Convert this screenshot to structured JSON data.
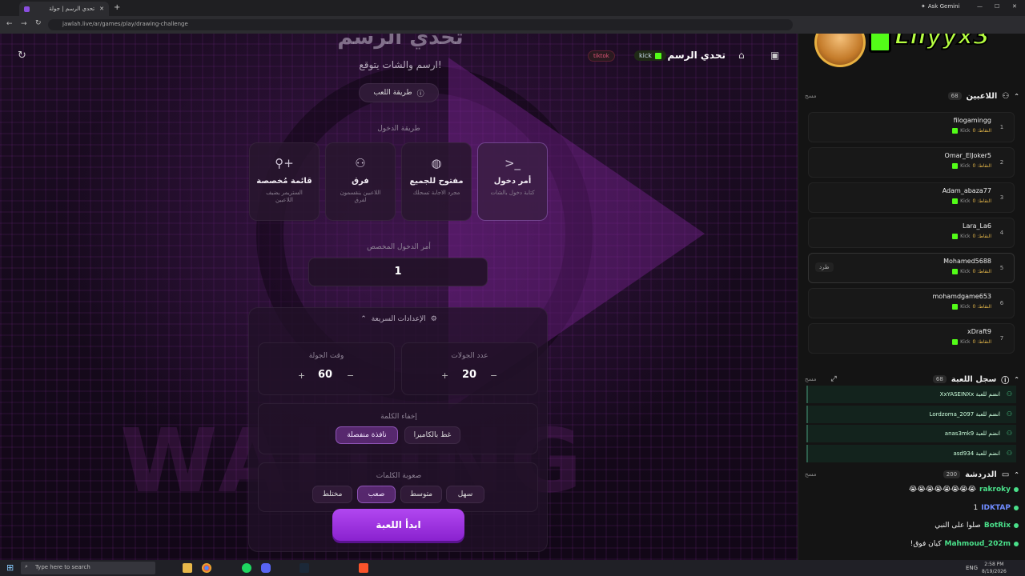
{
  "browser": {
    "tab_title": "تحدي الرسم | جولة",
    "url": "jawlah.live/ar/games/play/drawing-challenge",
    "ask_gemini": "Ask Gemini"
  },
  "overlay": {
    "streamer_name": "Lilyyx3"
  },
  "header": {
    "game_title": "تحدي الرسم",
    "kick_label": "kick",
    "tiktok_label": "tiktok"
  },
  "hero": {
    "title": "تحدي الرسم",
    "subtitle": "ارسم والشات يتوقع!",
    "how_to_play": "طريقة اللعب"
  },
  "entry": {
    "section_label": "طريقة الدخول",
    "options": [
      {
        "label": "أمر دخول",
        "desc": "كتابة دخول بالشات",
        "icon": "terminal-icon",
        "active": true
      },
      {
        "label": "مفتوح للجميع",
        "desc": "مجرد الاجابة تسجلك",
        "icon": "globe-icon",
        "active": false
      },
      {
        "label": "فرق",
        "desc": "اللاعبين ينقسمون لفرق",
        "icon": "users-icon",
        "active": false
      },
      {
        "label": "قائمة مُخصصة",
        "desc": "الستريمر يضيف اللاعبين",
        "icon": "user-plus-icon",
        "active": false
      }
    ],
    "custom_command_label": "أمر الدخول المخصص",
    "custom_command_value": "1"
  },
  "quick_settings": {
    "title": "الإعدادات السريعة",
    "rounds_label": "عدد الجولات",
    "rounds_value": "20",
    "round_time_label": "وقت الجولة",
    "round_time_value": "60",
    "hide_word_label": "إخفاء الكلمة",
    "hide_word_options": [
      "غط بالكاميرا",
      "نافذة منفصلة"
    ],
    "hide_word_selected": "نافذة منفصلة",
    "difficulty_label": "صعوبة الكلمات",
    "difficulty_options": [
      "سهل",
      "متوسط",
      "صعب",
      "مختلط"
    ],
    "difficulty_selected": "صعب"
  },
  "start_button": "ابدأ اللعبة",
  "sidebar": {
    "players_title": "اللاعبين",
    "players_count": "68",
    "clear_label": "مسح",
    "points_label": "النقاط: 0",
    "kick_tag": "Kick",
    "kick_player_btn": "طرد",
    "players": [
      {
        "rank": "1",
        "name": "filogamingg"
      },
      {
        "rank": "2",
        "name": "Omar_ElJoker5"
      },
      {
        "rank": "3",
        "name": "Adam_abaza77"
      },
      {
        "rank": "4",
        "name": "Lara_La6"
      },
      {
        "rank": "5",
        "name": "Mohamed5688"
      },
      {
        "rank": "6",
        "name": "mohamdgame653"
      },
      {
        "rank": "7",
        "name": "xDraft9"
      }
    ],
    "log_title": "سجل اللعبة",
    "log_count": "68",
    "log": [
      "XxYASEINXx انضم للعبة",
      "Lordzoma_2097 انضم للعبة",
      "anas3mk9 انضم للعبة",
      "asd934 انضم للعبة"
    ],
    "chat_title": "الدردشة",
    "chat_count": "200",
    "chat": [
      {
        "user": "rakroky",
        "msg": "😭😭😭😭😭😭😭😭",
        "color": "#4ae08a"
      },
      {
        "user": "IDKTAP",
        "msg": "1",
        "color": "#6f8bff"
      },
      {
        "user": "BotRix",
        "msg": "صلوا على النبي",
        "color": "#4ae08a"
      },
      {
        "user": "Mahmoud_202m",
        "msg": "كيان فوق!",
        "color": "#4ae08a"
      }
    ]
  },
  "taskbar": {
    "search_placeholder": "Type here to search",
    "time": "2:58 PM",
    "date": "8/19/2026",
    "lang": "ENG"
  },
  "colors": {
    "accent": "#9b3dde",
    "kick_green": "#53fc18",
    "start_btn": "#a334e8"
  }
}
